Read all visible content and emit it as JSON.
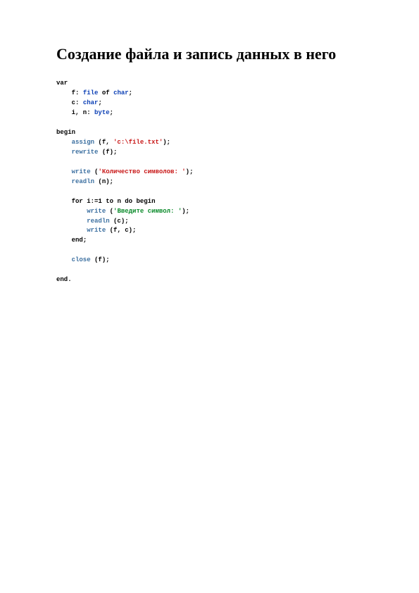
{
  "document": {
    "title": "Создание файла и запись данных в него"
  },
  "code": {
    "kw_var": "var",
    "decl_f_name": "f",
    "decl_f_type1": "file",
    "decl_f_of": "of",
    "decl_f_type2": "char",
    "decl_c_name": "c",
    "decl_c_type": "char",
    "decl_in_names": "i, n",
    "decl_in_type": "byte",
    "kw_begin": "begin",
    "call_assign": "assign",
    "assign_args_open": "(f, ",
    "str_path": "'c:\\file.txt'",
    "assign_args_close": ");",
    "call_rewrite": "rewrite",
    "rewrite_args": "(f);",
    "call_write1": "write",
    "write1_open": "(",
    "str_prompt1": "'Количество символов: '",
    "write1_close": ");",
    "call_readln1": "readln",
    "readln1_args": "(n);",
    "kw_for": "for",
    "for_expr": "i:=1",
    "kw_to": "to",
    "for_to": "n",
    "kw_do": "do",
    "kw_begin2": "begin",
    "call_write2": "write",
    "write2_open": "(",
    "str_prompt2": "'Введите символ: '",
    "write2_close": ");",
    "call_readln2": "readln",
    "readln2_args": "(c);",
    "call_write3": "write",
    "write3_args": "(f, c);",
    "kw_end_inner": "end",
    "semicolon": ";",
    "call_close": "close",
    "close_args": "(f);",
    "kw_end_final": "end",
    "period": "."
  }
}
